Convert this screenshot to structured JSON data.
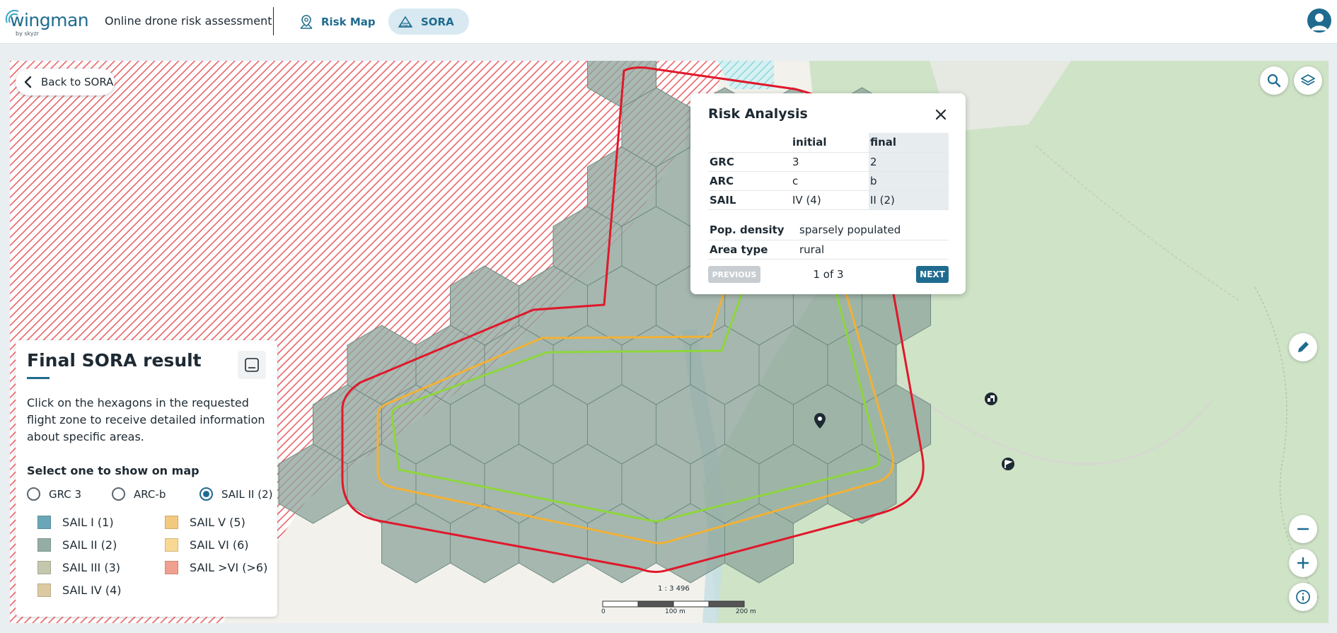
{
  "header": {
    "logo_text": "wingman",
    "logo_sub": "by skyzr",
    "app_title": "Online drone risk assessment",
    "tabs": [
      {
        "label": "Risk Map",
        "icon": "map-pin-icon",
        "active": false
      },
      {
        "label": "SORA",
        "icon": "sora-drone-icon",
        "active": true
      }
    ],
    "avatar_icon": "user-icon"
  },
  "map": {
    "back_label": "Back to SORA",
    "scale": {
      "ratio": "1 : 3 496",
      "ticks": [
        "0",
        "100 m",
        "200 m"
      ]
    },
    "colors": {
      "sail_ii_hex": "#8fa79d",
      "outer_contour": "#e0182a",
      "mid_contour": "#f2b135",
      "inner_contour": "#8ed63c",
      "prohibited_hatch": "#e8646a"
    }
  },
  "popup": {
    "title": "Risk Analysis",
    "columns": [
      "",
      "initial",
      "final"
    ],
    "rows": [
      {
        "label": "GRC",
        "initial": "3",
        "final": "2"
      },
      {
        "label": "ARC",
        "initial": "c",
        "final": "b"
      },
      {
        "label": "SAIL",
        "initial": "IV (4)",
        "final": "II (2)"
      }
    ],
    "info": [
      {
        "label": "Pop. density",
        "value": "sparsely populated"
      },
      {
        "label": "Area type",
        "value": "rural"
      }
    ],
    "prev_label": "PREVIOUS",
    "page": "1 of 3",
    "next_label": "NEXT"
  },
  "panel": {
    "title": "Final SORA result",
    "description": "Click on the hexagons in the requested flight zone to receive detailed information about specific areas.",
    "select_label": "Select one to show on map",
    "options": [
      {
        "label": "GRC 3",
        "selected": false
      },
      {
        "label": "ARC-b",
        "selected": false
      },
      {
        "label": "SAIL II (2)",
        "selected": true
      }
    ],
    "legend": [
      {
        "label": "SAIL I (1)",
        "color": "#6aa6b8"
      },
      {
        "label": "SAIL II (2)",
        "color": "#94aea6"
      },
      {
        "label": "SAIL III (3)",
        "color": "#c5c7ac"
      },
      {
        "label": "SAIL IV (4)",
        "color": "#dccba0"
      },
      {
        "label": "SAIL V (5)",
        "color": "#f2c97f"
      },
      {
        "label": "SAIL VI (6)",
        "color": "#f8d893"
      },
      {
        "label": "SAIL >VI (>6)",
        "color": "#f0a08f"
      }
    ]
  }
}
